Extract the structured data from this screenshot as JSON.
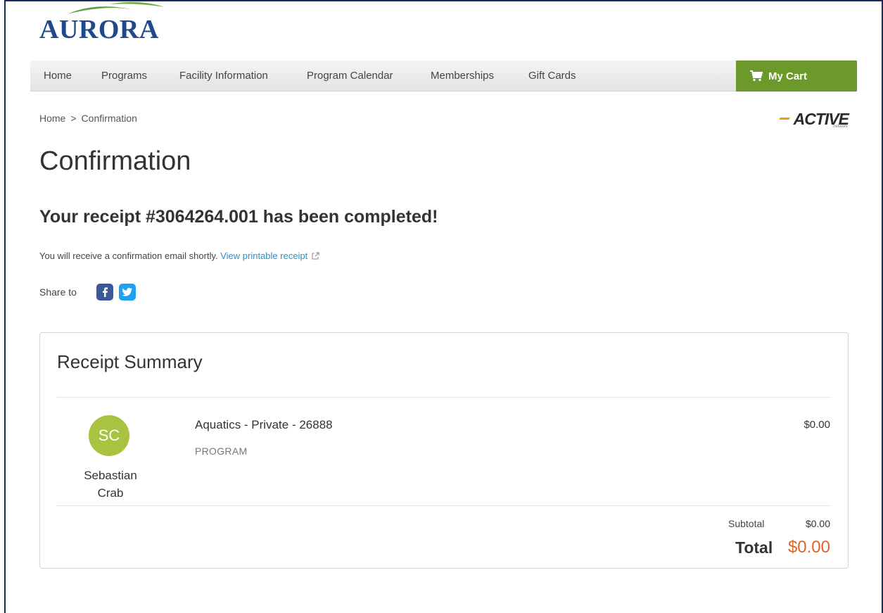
{
  "brand": {
    "logo_text": "AURORA"
  },
  "nav": {
    "items": [
      "Home",
      "Programs",
      "Facility Information",
      "Program Calendar",
      "Memberships",
      "Gift Cards"
    ],
    "cart_label": "My Cart",
    "cart_color": "#6b9a2b"
  },
  "breadcrumb": {
    "home": "Home",
    "separator": ">",
    "current": "Confirmation"
  },
  "partner_logo": {
    "name": "ACTIVE",
    "subtext": "network"
  },
  "page": {
    "title": "Confirmation",
    "receipt_message": "Your receipt #3064264.001 has been completed!",
    "email_message": "You will receive a confirmation email shortly.",
    "printable_link": "View printable receipt",
    "share_label": "Share to",
    "share_icons": [
      "facebook-icon",
      "twitter-icon"
    ]
  },
  "summary": {
    "title": "Receipt Summary",
    "items": [
      {
        "participant_initials": "SC",
        "participant_name": "Sebastian Crab",
        "name": "Aquatics - Private - 26888",
        "type": "PROGRAM",
        "price": "$0.00"
      }
    ],
    "subtotal_label": "Subtotal",
    "subtotal_value": "$0.00",
    "total_label": "Total",
    "total_value": "$0.00",
    "total_color": "#e0632a"
  }
}
